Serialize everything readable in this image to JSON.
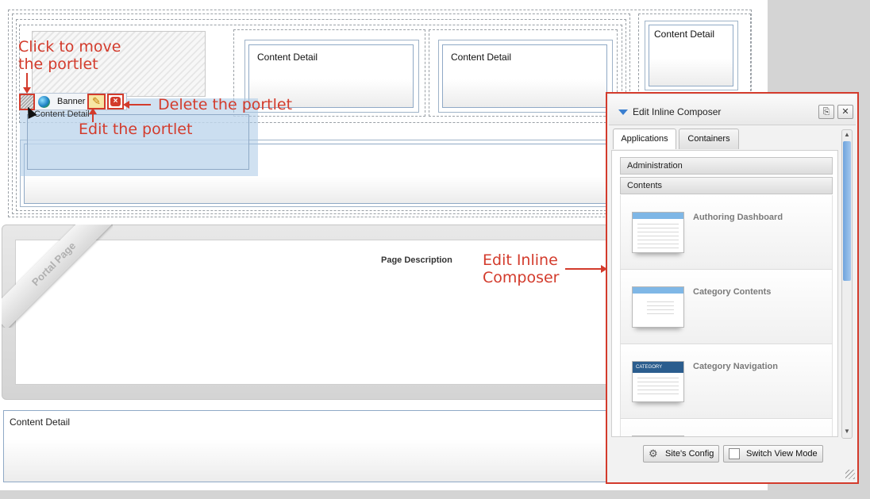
{
  "layout_panels": {
    "content_detail_label": "Content Detail"
  },
  "portlet": {
    "name": "Banner",
    "dragged_label": "Content Detail"
  },
  "portal_page": {
    "ribbon": "Portal Page",
    "description": "Page Description"
  },
  "annotations": {
    "move": "Click to move\nthe portlet",
    "move_line1": "Click to move",
    "move_line2": "the portlet",
    "delete": "Delete the portlet",
    "edit": "Edit the portlet",
    "composer_line1": "Edit Inline",
    "composer_line2": "Composer",
    "color": "#d33b2c"
  },
  "composer": {
    "title": "Edit Inline Composer",
    "tabs": [
      "Applications",
      "Containers"
    ],
    "active_tab": "Applications",
    "sections": {
      "administration": "Administration",
      "contents": "Contents"
    },
    "applications": [
      {
        "name": "Authoring Dashboard",
        "icon": "authoring-dashboard-thumbnail"
      },
      {
        "name": "Category Contents",
        "icon": "category-contents-thumbnail"
      },
      {
        "name": "Category Navigation",
        "icon": "category-navigation-thumbnail",
        "thumb_text": "CATEGORY"
      }
    ],
    "footer": {
      "sites_config": "Site's Config",
      "switch_view": "Switch View Mode"
    },
    "accent": "#3a7fd0"
  }
}
